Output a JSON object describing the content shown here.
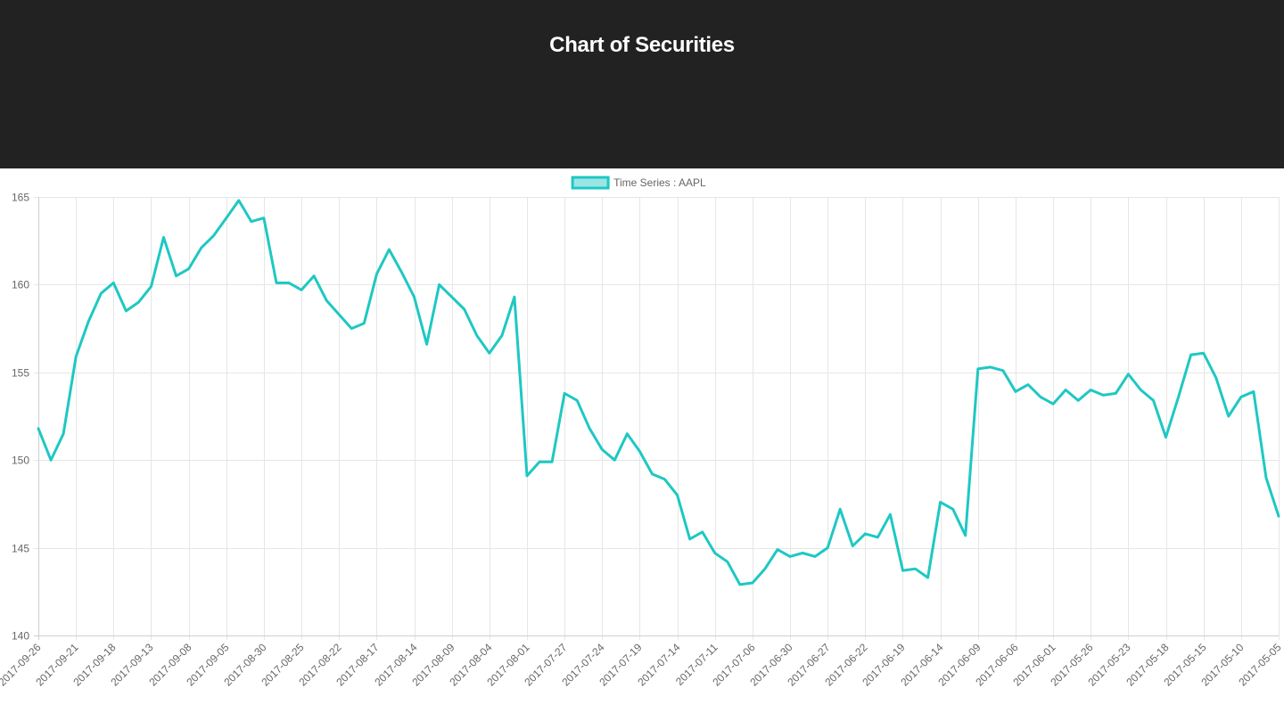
{
  "header": {
    "title": "Chart of Securities",
    "background": "#222222"
  },
  "chart_data": {
    "type": "line",
    "title": "",
    "xlabel": "",
    "ylabel": "",
    "ylim": [
      140,
      165
    ],
    "yticks": [
      140,
      145,
      150,
      155,
      160,
      165
    ],
    "grid": true,
    "legend_position": "top-center",
    "line_color": "#1ec8c3",
    "x_tick_labels": [
      "2017-09-26",
      "2017-09-21",
      "2017-09-18",
      "2017-09-13",
      "2017-09-08",
      "2017-09-05",
      "2017-08-30",
      "2017-08-25",
      "2017-08-22",
      "2017-08-17",
      "2017-08-14",
      "2017-08-09",
      "2017-08-04",
      "2017-08-01",
      "2017-07-27",
      "2017-07-24",
      "2017-07-19",
      "2017-07-14",
      "2017-07-11",
      "2017-07-06",
      "2017-06-30",
      "2017-06-27",
      "2017-06-22",
      "2017-06-19",
      "2017-06-14",
      "2017-06-09",
      "2017-06-06",
      "2017-06-01",
      "2017-05-26",
      "2017-05-23",
      "2017-05-18",
      "2017-05-15",
      "2017-05-10",
      "2017-05-05"
    ],
    "series": [
      {
        "name": "Time Series : AAPL",
        "values": [
          151.8,
          150.0,
          151.5,
          155.9,
          157.9,
          159.5,
          160.1,
          158.5,
          159.0,
          159.9,
          162.7,
          160.5,
          160.9,
          162.1,
          162.8,
          163.8,
          164.8,
          163.6,
          163.8,
          160.1,
          160.1,
          159.7,
          160.5,
          159.1,
          158.3,
          157.5,
          157.8,
          160.6,
          162.0,
          160.7,
          159.3,
          156.6,
          160.0,
          159.3,
          158.6,
          157.1,
          156.1,
          157.1,
          159.3,
          149.1,
          149.9,
          149.9,
          153.8,
          153.4,
          151.8,
          150.6,
          150.0,
          151.5,
          150.5,
          149.2,
          148.9,
          148.0,
          145.5,
          145.9,
          144.7,
          144.2,
          142.9,
          143.0,
          143.8,
          144.9,
          144.5,
          144.7,
          144.5,
          145.0,
          147.2,
          145.1,
          145.8,
          145.6,
          146.9,
          143.7,
          143.8,
          143.3,
          147.6,
          147.2,
          145.7,
          155.2,
          155.3,
          155.1,
          153.9,
          154.3,
          153.6,
          153.2,
          154.0,
          153.4,
          154.0,
          153.7,
          153.8,
          154.9,
          154.0,
          153.4,
          151.3,
          153.6,
          156.0,
          156.1,
          154.7,
          152.5,
          153.6,
          153.9,
          149.0,
          146.8
        ]
      }
    ]
  }
}
